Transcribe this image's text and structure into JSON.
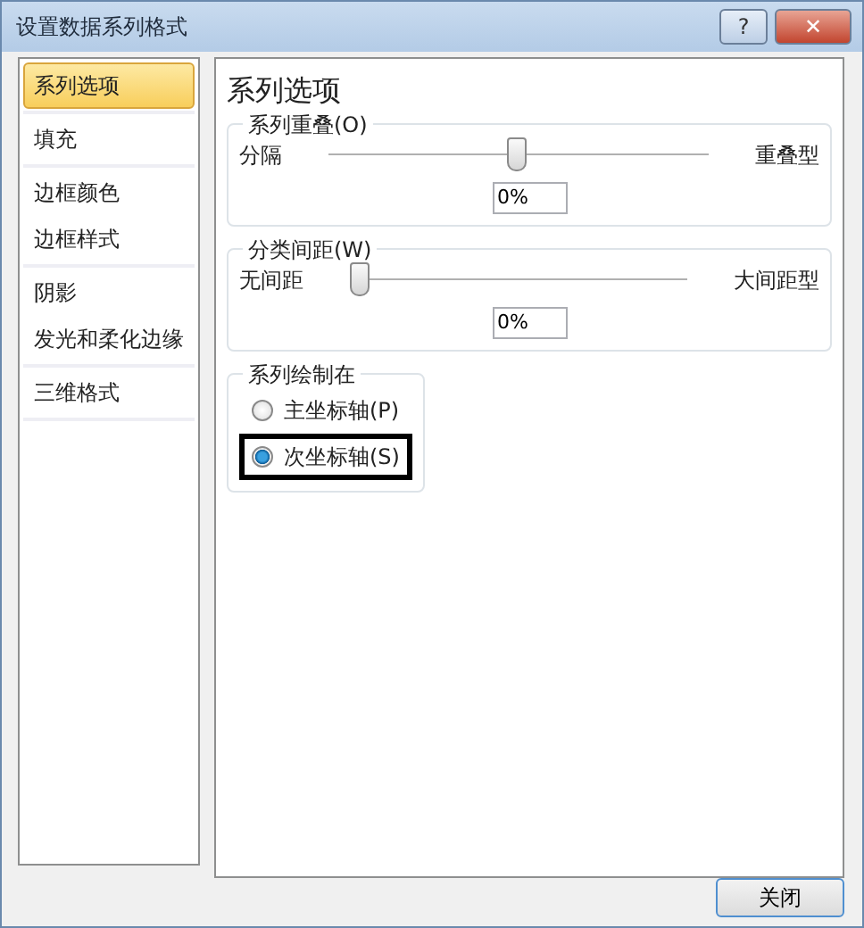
{
  "window": {
    "title": "设置数据系列格式",
    "help": "?",
    "close": "✕"
  },
  "sidebar": {
    "groups": [
      [
        {
          "label": "系列选项",
          "selected": true
        }
      ],
      [
        {
          "label": "填充",
          "selected": false
        }
      ],
      [
        {
          "label": "边框颜色",
          "selected": false
        },
        {
          "label": "边框样式",
          "selected": false
        }
      ],
      [
        {
          "label": "阴影",
          "selected": false
        },
        {
          "label": "发光和柔化边缘",
          "selected": false
        }
      ],
      [
        {
          "label": "三维格式",
          "selected": false
        }
      ]
    ]
  },
  "panel": {
    "title": "系列选项",
    "sliders": [
      {
        "legend": "系列重叠(O)",
        "min_label": "分隔",
        "max_label": "重叠型",
        "level": 0.5,
        "value": "0%"
      },
      {
        "legend": "分类间距(W)",
        "min_label": "无间距",
        "max_label": "大间距型",
        "level": 0,
        "value": "0%"
      }
    ],
    "plot_on": {
      "legend": "系列绘制在",
      "options": [
        {
          "label": "主坐标轴(P)",
          "selected": false,
          "highlighted": false
        },
        {
          "label": "次坐标轴(S)",
          "selected": true,
          "highlighted": true
        }
      ]
    }
  },
  "buttons": [
    "关闭"
  ]
}
